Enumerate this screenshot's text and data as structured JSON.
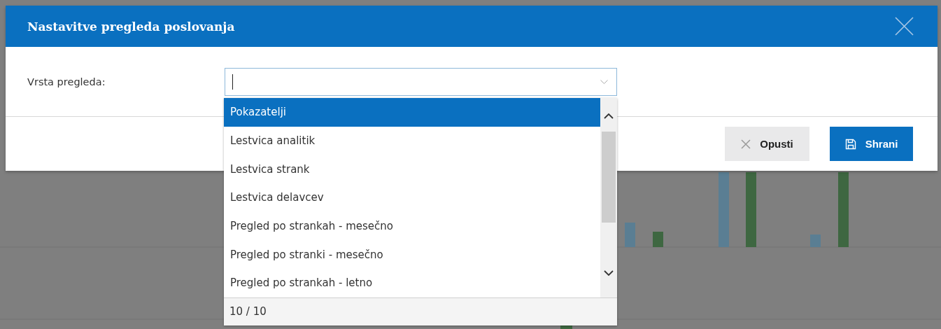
{
  "dialog": {
    "title": "Nastavitve pregleda poslovanja",
    "field": {
      "label": "Vrsta pregleda:",
      "focused": true
    },
    "dropdown": {
      "options": [
        {
          "label": "Pokazatelji",
          "selected": true
        },
        {
          "label": "Lestvica analitik",
          "selected": false
        },
        {
          "label": "Lestvica strank",
          "selected": false
        },
        {
          "label": "Lestvica delavcev",
          "selected": false
        },
        {
          "label": "Pregled po strankah - mesečno",
          "selected": false
        },
        {
          "label": "Pregled po stranki - mesečno",
          "selected": false
        },
        {
          "label": "Pregled po strankah - letno",
          "selected": false
        }
      ],
      "count": "10 / 10"
    },
    "buttons": [
      {
        "label": "Opusti",
        "kind": "cancel"
      },
      {
        "label": "Shrani",
        "kind": "save"
      }
    ]
  }
}
